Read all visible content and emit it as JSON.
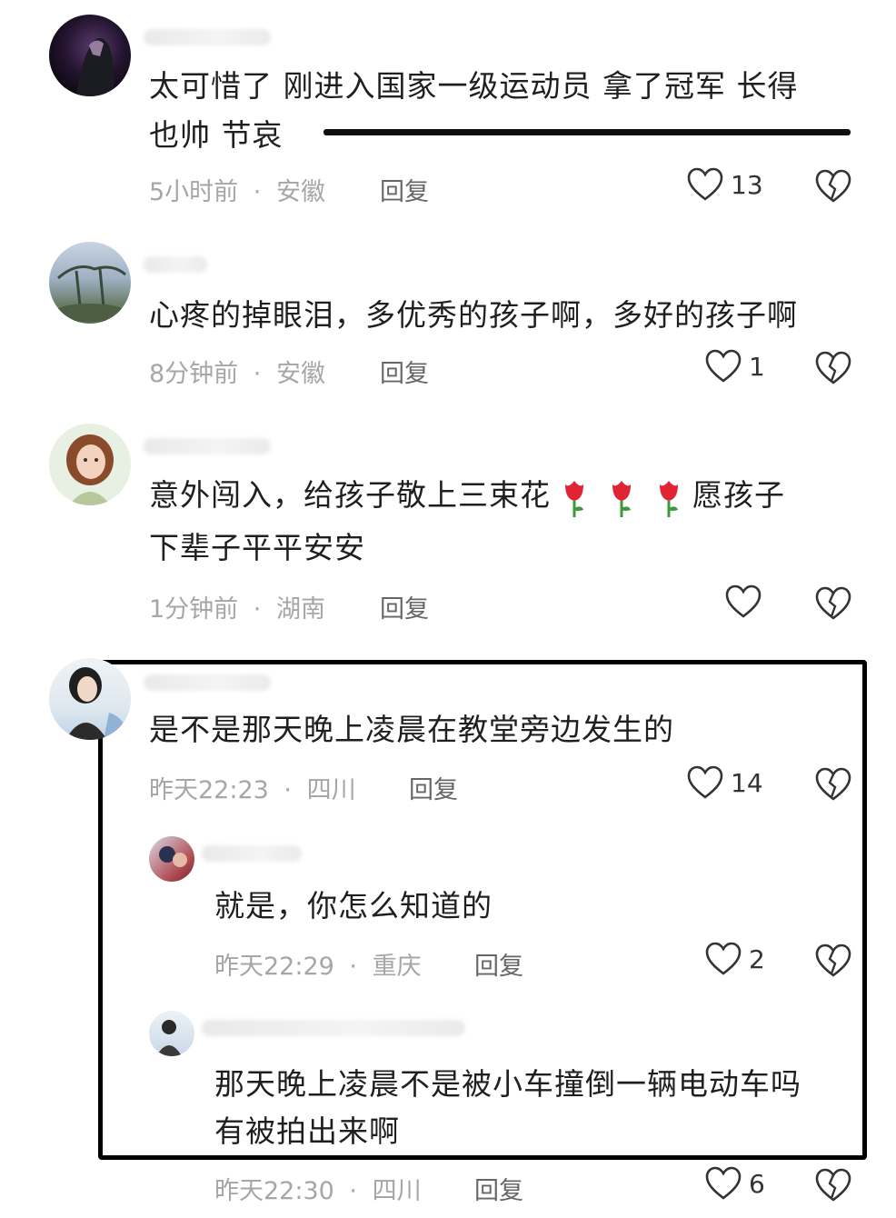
{
  "comments": [
    {
      "text_line1": "太可惜了 刚进入国家一级运动员 拿了冠军 长得",
      "text_line2": "也帅 节哀",
      "time": "5小时前",
      "region": "安徽",
      "reply": "回复",
      "likes": "13"
    },
    {
      "text_line1": "心疼的掉眼泪，多优秀的孩子啊，多好的孩子啊",
      "time": "8分钟前",
      "region": "安徽",
      "reply": "回复",
      "likes": "1"
    },
    {
      "text_line1_a": "意外闯入，给孩子敬上三束花",
      "text_line1_b": "愿孩子",
      "text_line2": "下辈子平平安安",
      "time": "1分钟前",
      "region": "湖南",
      "reply": "回复",
      "likes": ""
    },
    {
      "text_line1": "是不是那天晚上凌晨在教堂旁边发生的",
      "time": "昨天22:23",
      "region": "四川",
      "reply": "回复",
      "likes": "14"
    }
  ],
  "replies": [
    {
      "text_line1": "就是，你怎么知道的",
      "time": "昨天22:29",
      "region": "重庆",
      "reply": "回复",
      "likes": "2"
    },
    {
      "text_line1": "那天晚上凌晨不是被小车撞倒一辆电动车吗",
      "text_line2": "有被拍出来啊",
      "time": "昨天22:30",
      "region": "四川",
      "reply": "回复",
      "likes": "6"
    }
  ],
  "separator": "·",
  "colors": {
    "text": "#1f1f1f",
    "meta": "#a6a6a6",
    "heart": "#333333",
    "rose": "#e02434"
  }
}
